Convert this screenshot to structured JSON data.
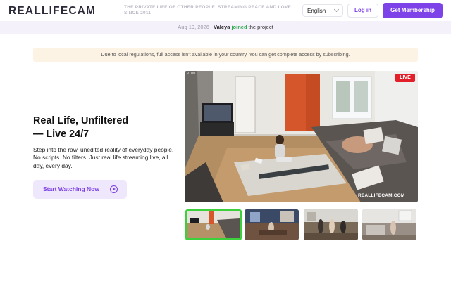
{
  "header": {
    "logo_left": "REAL",
    "logo_mid": "LIFE",
    "logo_right": "CAM",
    "tagline": "THE PRIVATE LIFE OF OTHER PEOPLE. STREAMING PEACE AND LOVE SINCE 2011",
    "language": "English",
    "login_label": "Log in",
    "membership_label": "Get Membership"
  },
  "notification": {
    "date": "Aug 19, 2026",
    "user": "Valeya",
    "action": "joined",
    "rest": "the project"
  },
  "banner": {
    "text": "Due to local regulations, full access isn't available in your country. You can get complete access by subscribing."
  },
  "hero": {
    "title_line1": "Real Life, Unfiltered",
    "title_line2": "— Live 24/7",
    "description": "Step into the raw, unedited reality of everyday people. No scripts. No filters. Just real life streaming live, all day, every day.",
    "cta_label": "Start Watching Now"
  },
  "player": {
    "live_badge": "LIVE",
    "timestamp": "8 09",
    "watermark": "REALLIFECAM.COM"
  },
  "thumbnails": [
    {
      "label": "camera-1",
      "active": true
    },
    {
      "label": "camera-2",
      "active": false
    },
    {
      "label": "camera-3",
      "active": false
    },
    {
      "label": "camera-4",
      "active": false
    }
  ],
  "colors": {
    "accent": "#7d42e8",
    "live": "#e3202a",
    "joined": "#2fa84f",
    "active_thumb_border": "#3cd13c",
    "banner_bg": "#fdf3e4"
  }
}
